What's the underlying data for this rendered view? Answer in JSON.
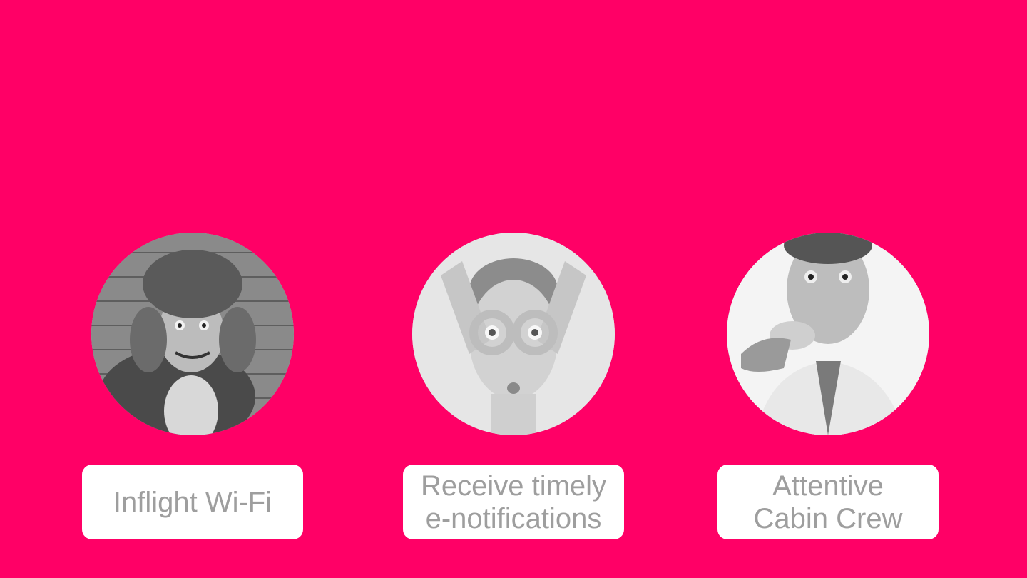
{
  "colors": {
    "background": "#FF0066",
    "card": "#FFFFFF",
    "label_text": "#9E9E9E"
  },
  "features": [
    {
      "image": "man-in-fur-trapper-hat-photo",
      "label_lines": [
        "Inflight Wi-Fi"
      ]
    },
    {
      "image": "woman-making-goggle-hands-photo",
      "label_lines": [
        "Receive timely",
        "e-notifications"
      ]
    },
    {
      "image": "man-eating-cookie-photo",
      "label_lines": [
        "Attentive",
        "Cabin Crew"
      ]
    }
  ]
}
